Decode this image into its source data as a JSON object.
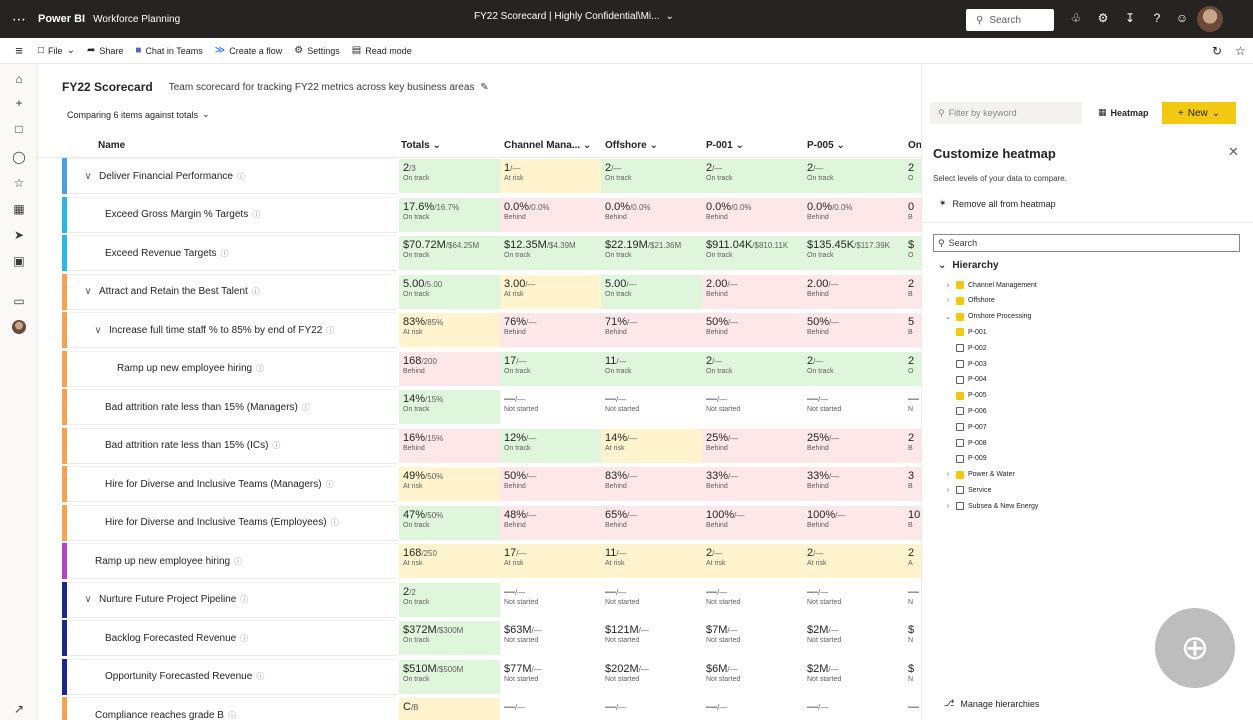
{
  "app": {
    "brand": "Power BI",
    "workspace": "Workforce Planning",
    "doc_title": "FY22 Scorecard | Highly Confidential\\Mi...",
    "search_placeholder": "Search"
  },
  "command_bar": {
    "file": "File",
    "share": "Share",
    "chat": "Chat in Teams",
    "flow": "Create a flow",
    "settings": "Settings",
    "read_mode": "Read mode"
  },
  "scorecard": {
    "title": "FY22 Scorecard",
    "description": "Team scorecard for tracking FY22 metrics across key business areas",
    "comparing": "Comparing 6 items against totals"
  },
  "columns": [
    "Name",
    "Totals",
    "Channel Mana...",
    "Offshore",
    "P-001",
    "P-005",
    "On"
  ],
  "rows": [
    {
      "name": "Deliver Financial Performance",
      "level": 0,
      "chev": "∨",
      "bar": "#50a0e0",
      "cells": [
        {
          "v": "2",
          "t": "/3",
          "s": "On track",
          "c": "g"
        },
        {
          "v": "1",
          "t": "/—",
          "s": "At risk",
          "c": "y"
        },
        {
          "v": "2",
          "t": "/—",
          "s": "On track",
          "c": "g"
        },
        {
          "v": "2",
          "t": "/—",
          "s": "On track",
          "c": "g"
        },
        {
          "v": "2",
          "t": "/—",
          "s": "On track",
          "c": "g"
        },
        {
          "v": "2",
          "t": "",
          "s": "O",
          "c": "g"
        }
      ]
    },
    {
      "name": "Exceed Gross Margin % Targets",
      "level": 1,
      "chev": "",
      "bar": "#2bb7e8",
      "cells": [
        {
          "v": "17.6%",
          "t": "/16.7%",
          "s": "On track",
          "c": "g"
        },
        {
          "v": "0.0%",
          "t": "/0.0%",
          "s": "Behind",
          "c": "r"
        },
        {
          "v": "0.0%",
          "t": "/0.0%",
          "s": "Behind",
          "c": "r"
        },
        {
          "v": "0.0%",
          "t": "/0.0%",
          "s": "Behind",
          "c": "r"
        },
        {
          "v": "0.0%",
          "t": "/0.0%",
          "s": "Behind",
          "c": "r"
        },
        {
          "v": "0",
          "t": "",
          "s": "B",
          "c": "r"
        }
      ]
    },
    {
      "name": "Exceed Revenue Targets",
      "level": 1,
      "chev": "",
      "bar": "#2bb7e8",
      "cells": [
        {
          "v": "$70.72M",
          "t": "/$64.25M",
          "s": "On track",
          "c": "g"
        },
        {
          "v": "$12.35M",
          "t": "/$4.39M",
          "s": "On track",
          "c": "g"
        },
        {
          "v": "$22.19M",
          "t": "/$21.36M",
          "s": "On track",
          "c": "g"
        },
        {
          "v": "$911.04K",
          "t": "/$810.11K",
          "s": "On track",
          "c": "g"
        },
        {
          "v": "$135.45K",
          "t": "/$117.39K",
          "s": "On track",
          "c": "g"
        },
        {
          "v": "$",
          "t": "",
          "s": "O",
          "c": "g"
        }
      ]
    },
    {
      "name": "Attract and Retain the Best Talent",
      "level": 0,
      "chev": "∨",
      "bar": "#f7a154",
      "cells": [
        {
          "v": "5.00",
          "t": "/5.00",
          "s": "On track",
          "c": "g"
        },
        {
          "v": "3.00",
          "t": "/—",
          "s": "At risk",
          "c": "y"
        },
        {
          "v": "5.00",
          "t": "/—",
          "s": "On track",
          "c": "g"
        },
        {
          "v": "2.00",
          "t": "/—",
          "s": "Behind",
          "c": "r"
        },
        {
          "v": "2.00",
          "t": "/—",
          "s": "Behind",
          "c": "r"
        },
        {
          "v": "2",
          "t": "",
          "s": "B",
          "c": "r"
        }
      ]
    },
    {
      "name": "Increase full time staff % to 85% by end of FY22",
      "level": 1,
      "chev": "∨",
      "bar": "#f7a154",
      "cells": [
        {
          "v": "83%",
          "t": "/85%",
          "s": "At risk",
          "c": "y"
        },
        {
          "v": "76%",
          "t": "/—",
          "s": "Behind",
          "c": "r"
        },
        {
          "v": "71%",
          "t": "/—",
          "s": "Behind",
          "c": "r"
        },
        {
          "v": "50%",
          "t": "/—",
          "s": "Behind",
          "c": "r"
        },
        {
          "v": "50%",
          "t": "/—",
          "s": "Behind",
          "c": "r"
        },
        {
          "v": "5",
          "t": "",
          "s": "B",
          "c": "r"
        }
      ]
    },
    {
      "name": "Ramp up new employee hiring",
      "level": 2,
      "chev": "",
      "bar": "#f7a154",
      "cells": [
        {
          "v": "168",
          "t": "/200",
          "s": "Behind",
          "c": "r"
        },
        {
          "v": "17",
          "t": "/—",
          "s": "On track",
          "c": "g"
        },
        {
          "v": "11",
          "t": "/—",
          "s": "On track",
          "c": "g"
        },
        {
          "v": "2",
          "t": "/—",
          "s": "On track",
          "c": "g"
        },
        {
          "v": "2",
          "t": "/—",
          "s": "On track",
          "c": "g"
        },
        {
          "v": "2",
          "t": "",
          "s": "O",
          "c": "g"
        }
      ]
    },
    {
      "name": "Bad attrition rate less than 15% (Managers)",
      "level": 1,
      "chev": "",
      "bar": "#f7a154",
      "cells": [
        {
          "v": "14%",
          "t": "/15%",
          "s": "On track",
          "c": "g"
        },
        {
          "v": "—",
          "t": "/—",
          "s": "Not started",
          "c": "n"
        },
        {
          "v": "—",
          "t": "/—",
          "s": "Not started",
          "c": "n"
        },
        {
          "v": "—",
          "t": "/—",
          "s": "Not started",
          "c": "n"
        },
        {
          "v": "—",
          "t": "/—",
          "s": "Not started",
          "c": "n"
        },
        {
          "v": "—",
          "t": "",
          "s": "N",
          "c": "n"
        }
      ]
    },
    {
      "name": "Bad attrition rate less than 15% (ICs)",
      "level": 1,
      "chev": "",
      "bar": "#f7a154",
      "cells": [
        {
          "v": "16%",
          "t": "/15%",
          "s": "Behind",
          "c": "r"
        },
        {
          "v": "12%",
          "t": "/—",
          "s": "On track",
          "c": "g"
        },
        {
          "v": "14%",
          "t": "/—",
          "s": "At risk",
          "c": "y"
        },
        {
          "v": "25%",
          "t": "/—",
          "s": "Behind",
          "c": "r"
        },
        {
          "v": "25%",
          "t": "/—",
          "s": "Behind",
          "c": "r"
        },
        {
          "v": "2",
          "t": "",
          "s": "B",
          "c": "r"
        }
      ]
    },
    {
      "name": "Hire for Diverse and Inclusive Teams (Managers)",
      "level": 1,
      "chev": "",
      "bar": "#f7a154",
      "cells": [
        {
          "v": "49%",
          "t": "/50%",
          "s": "At risk",
          "c": "y"
        },
        {
          "v": "50%",
          "t": "/—",
          "s": "Behind",
          "c": "r"
        },
        {
          "v": "83%",
          "t": "/—",
          "s": "Behind",
          "c": "r"
        },
        {
          "v": "33%",
          "t": "/—",
          "s": "Behind",
          "c": "r"
        },
        {
          "v": "33%",
          "t": "/—",
          "s": "Behind",
          "c": "r"
        },
        {
          "v": "3",
          "t": "",
          "s": "B",
          "c": "r"
        }
      ]
    },
    {
      "name": "Hire for Diverse and Inclusive Teams (Employees)",
      "level": 1,
      "chev": "",
      "bar": "#f7a154",
      "cells": [
        {
          "v": "47%",
          "t": "/50%",
          "s": "On track",
          "c": "g"
        },
        {
          "v": "48%",
          "t": "/—",
          "s": "Behind",
          "c": "r"
        },
        {
          "v": "65%",
          "t": "/—",
          "s": "Behind",
          "c": "r"
        },
        {
          "v": "100%",
          "t": "/—",
          "s": "Behind",
          "c": "r"
        },
        {
          "v": "100%",
          "t": "/—",
          "s": "Behind",
          "c": "r"
        },
        {
          "v": "10",
          "t": "",
          "s": "B",
          "c": "r"
        }
      ]
    },
    {
      "name": "Ramp up new employee hiring",
      "level": 0,
      "chev": "",
      "bar": "#b146c2",
      "cells": [
        {
          "v": "168",
          "t": "/250",
          "s": "At risk",
          "c": "y"
        },
        {
          "v": "17",
          "t": "/—",
          "s": "At risk",
          "c": "y"
        },
        {
          "v": "11",
          "t": "/—",
          "s": "At risk",
          "c": "y"
        },
        {
          "v": "2",
          "t": "/—",
          "s": "At risk",
          "c": "y"
        },
        {
          "v": "2",
          "t": "/—",
          "s": "At risk",
          "c": "y"
        },
        {
          "v": "2",
          "t": "",
          "s": "A",
          "c": "y"
        }
      ]
    },
    {
      "name": "Nurture Future Project Pipeline",
      "level": 0,
      "chev": "∨",
      "bar": "#1b2a8a",
      "cells": [
        {
          "v": "2",
          "t": "/2",
          "s": "On track",
          "c": "g"
        },
        {
          "v": "—",
          "t": "/—",
          "s": "Not started",
          "c": "n"
        },
        {
          "v": "—",
          "t": "/—",
          "s": "Not started",
          "c": "n"
        },
        {
          "v": "—",
          "t": "/—",
          "s": "Not started",
          "c": "n"
        },
        {
          "v": "—",
          "t": "/—",
          "s": "Not started",
          "c": "n"
        },
        {
          "v": "—",
          "t": "",
          "s": "N",
          "c": "n"
        }
      ]
    },
    {
      "name": "Backlog Forecasted Revenue",
      "level": 1,
      "chev": "",
      "bar": "#1b2a8a",
      "cells": [
        {
          "v": "$372M",
          "t": "/$300M",
          "s": "On track",
          "c": "g"
        },
        {
          "v": "$63M",
          "t": "/—",
          "s": "Not started",
          "c": "n"
        },
        {
          "v": "$121M",
          "t": "/—",
          "s": "Not started",
          "c": "n"
        },
        {
          "v": "$7M",
          "t": "/—",
          "s": "Not started",
          "c": "n"
        },
        {
          "v": "$2M",
          "t": "/—",
          "s": "Not started",
          "c": "n"
        },
        {
          "v": "$",
          "t": "",
          "s": "N",
          "c": "n"
        }
      ]
    },
    {
      "name": "Opportunity Forecasted Revenue",
      "level": 1,
      "chev": "",
      "bar": "#1b2a8a",
      "cells": [
        {
          "v": "$510M",
          "t": "/$500M",
          "s": "On track",
          "c": "g"
        },
        {
          "v": "$77M",
          "t": "/—",
          "s": "Not started",
          "c": "n"
        },
        {
          "v": "$202M",
          "t": "/—",
          "s": "Not started",
          "c": "n"
        },
        {
          "v": "$6M",
          "t": "/—",
          "s": "Not started",
          "c": "n"
        },
        {
          "v": "$2M",
          "t": "/—",
          "s": "Not started",
          "c": "n"
        },
        {
          "v": "$",
          "t": "",
          "s": "N",
          "c": "n"
        }
      ]
    },
    {
      "name": "Compliance reaches grade B",
      "level": 0,
      "chev": "",
      "bar": "#f7a154",
      "cells": [
        {
          "v": "C",
          "t": "/B",
          "s": "",
          "c": "y"
        },
        {
          "v": "—",
          "t": "/—",
          "s": "",
          "c": "n"
        },
        {
          "v": "—",
          "t": "/—",
          "s": "",
          "c": "n"
        },
        {
          "v": "—",
          "t": "/—",
          "s": "",
          "c": "n"
        },
        {
          "v": "—",
          "t": "/—",
          "s": "",
          "c": "n"
        },
        {
          "v": "—",
          "t": "",
          "s": "",
          "c": "n"
        }
      ]
    }
  ],
  "toolbar": {
    "filter_placeholder": "Filter by keyword",
    "heatmap": "Heatmap",
    "new": "New"
  },
  "heatmap_panel": {
    "title": "Customize heatmap",
    "subtitle": "Select levels of your data to compare.",
    "remove_all": "Remove all from heatmap",
    "search_placeholder": "Search",
    "hierarchy_label": "Hierarchy",
    "tree": [
      {
        "label": "Channel Management",
        "indent": 1,
        "chev": ">",
        "checked": true
      },
      {
        "label": "Offshore",
        "indent": 1,
        "chev": ">",
        "checked": true
      },
      {
        "label": "Onshore Processing",
        "indent": 1,
        "chev": "∨",
        "checked": true
      },
      {
        "label": "P-001",
        "indent": 2,
        "chev": "",
        "checked": true
      },
      {
        "label": "P-002",
        "indent": 2,
        "chev": "",
        "checked": false
      },
      {
        "label": "P-003",
        "indent": 2,
        "chev": "",
        "checked": false
      },
      {
        "label": "P-004",
        "indent": 2,
        "chev": "",
        "checked": false
      },
      {
        "label": "P-005",
        "indent": 2,
        "chev": "",
        "checked": true
      },
      {
        "label": "P-006",
        "indent": 2,
        "chev": "",
        "checked": false
      },
      {
        "label": "P-007",
        "indent": 2,
        "chev": "",
        "checked": false
      },
      {
        "label": "P-008",
        "indent": 2,
        "chev": "",
        "checked": false
      },
      {
        "label": "P-009",
        "indent": 2,
        "chev": "",
        "checked": false
      },
      {
        "label": "Power & Water",
        "indent": 1,
        "chev": ">",
        "checked": true
      },
      {
        "label": "Service",
        "indent": 1,
        "chev": ">",
        "checked": false
      },
      {
        "label": "Subsea & New Energy",
        "indent": 1,
        "chev": ">",
        "checked": false
      }
    ],
    "manage": "Manage hierarchies"
  },
  "colors": {
    "on_track": "#dff6dd",
    "at_risk": "#fff4ce",
    "behind": "#fde7e9",
    "accent": "#f2c811"
  }
}
